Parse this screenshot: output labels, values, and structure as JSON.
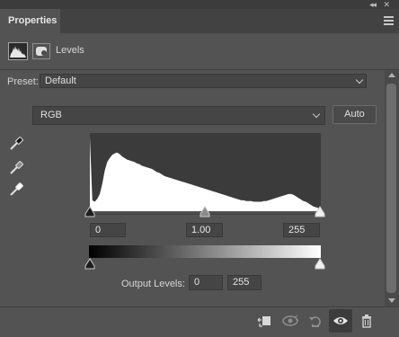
{
  "panel": {
    "tab_title": "Properties",
    "adjustment_name": "Levels"
  },
  "preset": {
    "label": "Preset:",
    "value": "Default"
  },
  "channel": {
    "value": "RGB",
    "auto_label": "Auto"
  },
  "input_levels": {
    "black": "0",
    "gamma": "1.00",
    "white": "255"
  },
  "output_levels": {
    "label": "Output Levels:",
    "black": "0",
    "white": "255"
  },
  "icons": {
    "collapse": "collapse-panel-icon",
    "close": "close-icon",
    "menu": "panel-menu-icon",
    "adjustment": "levels-histogram-icon",
    "mask": "layer-mask-icon",
    "eyedroppers": [
      "black-point-eyedropper-icon",
      "gray-point-eyedropper-icon",
      "white-point-eyedropper-icon"
    ],
    "footer": [
      "clip-to-layer-icon",
      "view-previous-state-icon",
      "reset-adjustment-icon",
      "toggle-visibility-icon",
      "delete-adjustment-icon"
    ]
  },
  "histogram": {
    "color": "#ffffff",
    "background": "#3b3b3b",
    "levels": [
      0.95,
      0.14,
      0.12,
      0.16,
      0.22,
      0.35,
      0.52,
      0.63,
      0.68,
      0.72,
      0.74,
      0.75,
      0.73,
      0.7,
      0.68,
      0.66,
      0.65,
      0.64,
      0.63,
      0.61,
      0.6,
      0.58,
      0.57,
      0.56,
      0.55,
      0.54,
      0.52,
      0.5,
      0.49,
      0.47,
      0.45,
      0.44,
      0.43,
      0.42,
      0.41,
      0.4,
      0.39,
      0.38,
      0.37,
      0.36,
      0.35,
      0.34,
      0.33,
      0.32,
      0.31,
      0.3,
      0.29,
      0.28,
      0.27,
      0.26,
      0.25,
      0.24,
      0.23,
      0.22,
      0.21,
      0.2,
      0.19,
      0.18,
      0.17,
      0.16,
      0.15,
      0.14,
      0.14,
      0.13,
      0.13,
      0.13,
      0.12,
      0.12,
      0.12,
      0.12,
      0.13,
      0.13,
      0.14,
      0.15,
      0.16,
      0.17,
      0.18,
      0.19,
      0.2,
      0.21,
      0.22,
      0.22,
      0.21,
      0.19,
      0.17,
      0.15,
      0.13,
      0.12,
      0.1,
      0.08,
      0.06,
      0.05,
      0.04,
      0.03
    ]
  }
}
